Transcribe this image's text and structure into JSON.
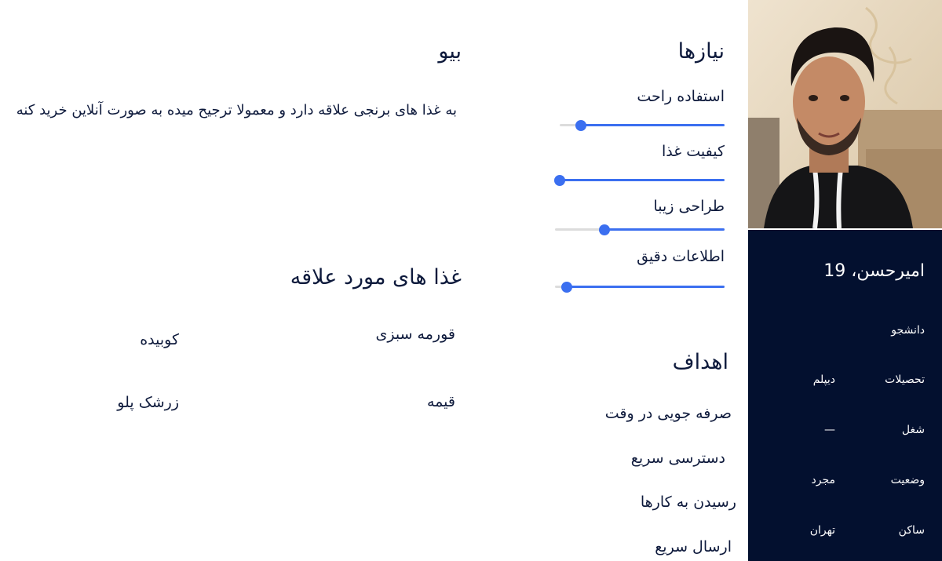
{
  "profile": {
    "name": "امیرحسن، 19",
    "role": "دانشجو",
    "info": [
      {
        "label": "تحصیلات",
        "value": "دیپلم"
      },
      {
        "label": "شغل",
        "value": "—"
      },
      {
        "label": "وضعیت",
        "value": "مجرد"
      },
      {
        "label": "ساکن",
        "value": "تهران"
      }
    ]
  },
  "needs": {
    "title": "نیازها",
    "items": [
      {
        "label": "استفاده راحت",
        "level": 0.87
      },
      {
        "label": "کیفیت غذا",
        "level": 1.0
      },
      {
        "label": "طراحی زیبا",
        "level": 0.71
      },
      {
        "label": "اطلاعات دقیق",
        "level": 0.93
      }
    ]
  },
  "goals": {
    "title": "اهداف",
    "items": [
      "صرفه جویی در وقت",
      "دسترسی سریع",
      "رسیدن به کارها",
      "ارسال سریع"
    ]
  },
  "bio": {
    "title": "بیو",
    "text": "به غذا های برنجی علاقه دارد و معمولا ترجیح میده به صورت آنلاین خرید کنه"
  },
  "favorites": {
    "title": "غذا های مورد علاقه",
    "items": [
      "قورمه سبزی",
      "کوبیده",
      "قیمه",
      "زرشک پلو"
    ]
  },
  "colors": {
    "profile_card_bg": "#03102f",
    "accent": "#3b6ff0",
    "text": "#0e1a3c"
  }
}
